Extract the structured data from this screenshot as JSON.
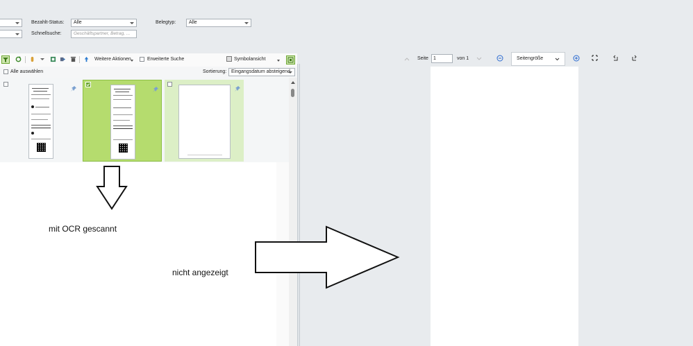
{
  "filters": {
    "bezahlt_status": {
      "label": "Bezahlt-Status:",
      "value": "Alle"
    },
    "belegtyp": {
      "label": "Belegtyp:",
      "value": "Alle"
    },
    "schnellsuche": {
      "label": "Schnellsuche:",
      "placeholder": "Geschäftspartner, Betrag, ..."
    }
  },
  "toolbar": {
    "weitere_aktionen": "Weitere Aktionen",
    "erweiterte_suche": "Erweiterte Suche",
    "ansicht": "Symbolansicht"
  },
  "list_header": {
    "alle_auswaehlen": "Alle auswählen",
    "sortierung_label": "Sortierung:",
    "sortierung_value": "Eingangsdatum absteigend"
  },
  "viewer": {
    "seite_label": "Seite",
    "seite_value": "1",
    "von_label": "von 1",
    "zoom_value": "Seitengröße"
  },
  "annotations": {
    "ocr_text": "mit OCR gescannt",
    "not_shown_text": "nicht angezeigt"
  },
  "colors": {
    "selected_card": "#b5dc6e",
    "third_card": "#dcefc6",
    "accent_green": "#6aa62e"
  }
}
